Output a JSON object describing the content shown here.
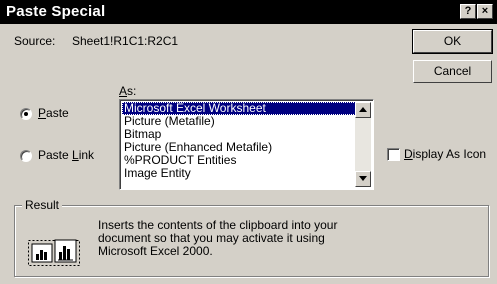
{
  "title": "Paste Special",
  "titlebar": {
    "help_label": "?",
    "close_label": "×"
  },
  "source": {
    "label": "Source:",
    "value": "Sheet1!R1C1:R2C1"
  },
  "buttons": {
    "ok": "OK",
    "cancel": "Cancel"
  },
  "as_label": {
    "accel": "A",
    "rest": "s:"
  },
  "paste_radio": {
    "accel": "P",
    "rest": "aste",
    "selected": true
  },
  "paste_link_radio": {
    "before": "Paste ",
    "accel": "L",
    "rest": "ink",
    "selected": false
  },
  "list": {
    "items": [
      "Microsoft Excel Worksheet",
      "Picture (Metafile)",
      "Bitmap",
      "Picture (Enhanced Metafile)",
      "%PRODUCT Entities",
      "Image Entity"
    ],
    "selected_index": 0
  },
  "display_as_icon": {
    "accel": "D",
    "rest": "isplay As Icon",
    "checked": false
  },
  "result": {
    "legend": "Result",
    "text": "Inserts the contents of the clipboard into your document so that you may activate it using Microsoft Excel 2000."
  },
  "colors": {
    "selection": "#000080",
    "face": "#d4d0c8",
    "titlebar": "#000000"
  }
}
